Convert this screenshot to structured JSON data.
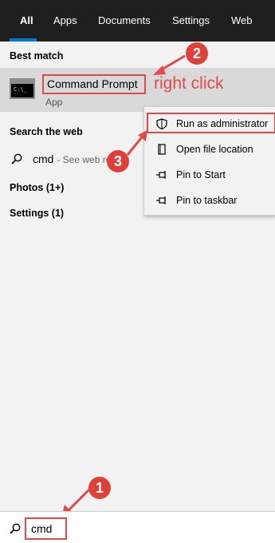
{
  "tabs": [
    {
      "label": "All"
    },
    {
      "label": "Apps"
    },
    {
      "label": "Documents"
    },
    {
      "label": "Settings"
    },
    {
      "label": "Web"
    }
  ],
  "best_match": {
    "heading": "Best match",
    "app_name": "Command Prompt",
    "app_type": "App",
    "icon_text": "C:\\_"
  },
  "web": {
    "heading": "Search the web",
    "query": "cmd",
    "hint": "- See web result"
  },
  "categories": [
    {
      "label": "Photos (1+)"
    },
    {
      "label": "Settings (1)"
    }
  ],
  "context_menu": [
    {
      "label": "Run as administrator",
      "icon": "shield-icon"
    },
    {
      "label": "Open file location",
      "icon": "folder-icon"
    },
    {
      "label": "Pin to Start",
      "icon": "pin-icon"
    },
    {
      "label": "Pin to taskbar",
      "icon": "pin-icon"
    }
  ],
  "annotations": {
    "step1": "1",
    "step2": "2",
    "step3": "3",
    "right_click_text": "right click"
  },
  "search_box": {
    "value": "cmd"
  },
  "colors": {
    "tabbar_bg": "#1f1f1f",
    "accent": "#0078d7",
    "annotation_red": "#e14a4a"
  }
}
